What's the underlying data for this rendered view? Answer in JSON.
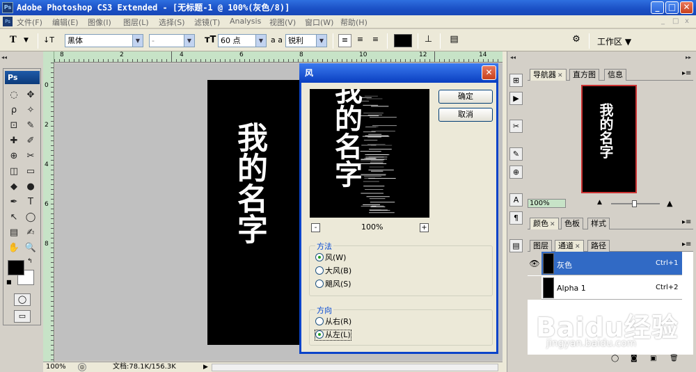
{
  "app": {
    "title": "Adobe Photoshop CS3 Extended - [无标题-1 @ 100%(灰色/8)]",
    "logo": "Ps",
    "window_buttons": [
      "_",
      "□",
      "✕"
    ]
  },
  "menu": {
    "items": [
      "文件(F)",
      "编辑(E)",
      "图像(I)",
      "图层(L)",
      "选择(S)",
      "滤镜(T)",
      "Analysis",
      "视图(V)",
      "窗口(W)",
      "帮助(H)"
    ],
    "doc_controls": [
      "_",
      "□",
      "x"
    ]
  },
  "options": {
    "tool_glyph": "T",
    "font_family": "黑体",
    "font_style": "-",
    "font_size": "60 点",
    "aa_label": "a a",
    "antialias": "锐利",
    "color_swatch": "#000000",
    "workspace_label": "工作区 ▼"
  },
  "toolbox": {
    "logo": "Ps",
    "tools": [
      "◌",
      "✥",
      "ρ",
      "✧",
      "⊡",
      "✎",
      "✚",
      "✐",
      "⊕",
      "✂",
      "◫",
      "▭",
      "◆",
      "●",
      "✒",
      "T",
      "↖",
      "◯",
      "▤",
      "✍",
      "✋",
      "🔍"
    ],
    "fg_color": "#000000",
    "bg_color": "#ffffff"
  },
  "rulers": {
    "top": [
      "8",
      "2",
      "4",
      "6",
      "8",
      "10",
      "12",
      "14"
    ],
    "left": [
      "0",
      "2",
      "4",
      "6",
      "8"
    ]
  },
  "document": {
    "text": "我的名字",
    "background": "#000000"
  },
  "status": {
    "zoom": "100%",
    "doc_size": "文档:78.1K/156.3K",
    "arrow": "▶"
  },
  "dialog": {
    "title": "风",
    "ok": "确定",
    "cancel": "取消",
    "zoom": "100%",
    "zoom_minus": "-",
    "zoom_plus": "+",
    "method": {
      "title": "方法",
      "options": [
        "风(W)",
        "大风(B)",
        "飓风(S)"
      ],
      "selected": 0
    },
    "direction": {
      "title": "方向",
      "options": [
        "从右(R)",
        "从左(L)"
      ],
      "selected": 1
    }
  },
  "navigator": {
    "tabs": [
      "导航器",
      "直方图",
      "信息"
    ],
    "preview_text": "我的名字",
    "zoom": "100%"
  },
  "color_panel": {
    "tabs": [
      "颜色",
      "色板",
      "样式"
    ]
  },
  "layers_panel": {
    "tabs": [
      "图层",
      "通道",
      "路径"
    ],
    "channels": [
      {
        "name": "灰色",
        "shortcut": "Ctrl+1",
        "visible": true,
        "selected": true
      },
      {
        "name": "Alpha 1",
        "shortcut": "Ctrl+2",
        "visible": false,
        "selected": false
      }
    ]
  },
  "watermark": {
    "brand": "Baidu经验",
    "url": "jingyan.baidu.com"
  }
}
